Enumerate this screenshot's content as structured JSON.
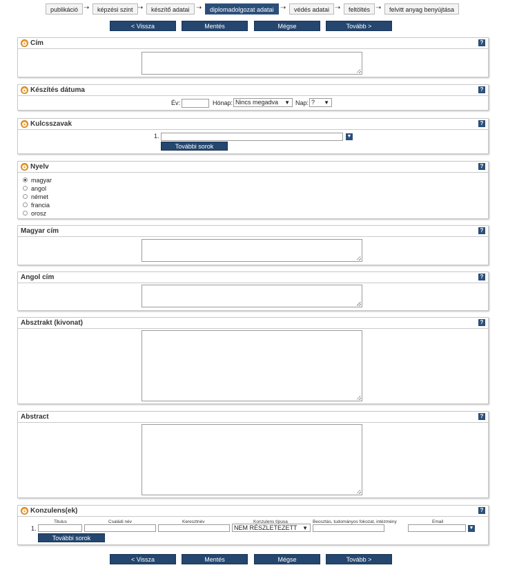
{
  "wizard": {
    "steps": [
      "publikáció",
      "képzési szint",
      "készítő adatai",
      "diplomadolgozat adatai",
      "védés adatai",
      "feltöltés",
      "felvitt anyag benyújtása"
    ],
    "active_step": "diplomadolgozat adatai"
  },
  "nav": {
    "back": "< Vissza",
    "save": "Mentés",
    "cancel": "Mégse",
    "next": "Tovább >"
  },
  "sections": {
    "title": {
      "label": "Cím",
      "required": true
    },
    "date": {
      "label": "Készítés dátuma",
      "year_label": "Év:",
      "year_value": "",
      "month_label": "Hónap:",
      "month_value": "Nincs megadva",
      "day_label": "Nap:",
      "day_value": "?"
    },
    "keywords": {
      "label": "Kulcsszavak",
      "row_number": "1.",
      "more_rows": "További sorok"
    },
    "language": {
      "label": "Nyelv",
      "options": [
        "magyar",
        "angol",
        "német",
        "francia",
        "orosz"
      ],
      "selected": "magyar"
    },
    "hungarian_title": {
      "label": "Magyar cím"
    },
    "english_title": {
      "label": "Angol cím"
    },
    "abstract_hu": {
      "label": "Absztrakt (kivonat)"
    },
    "abstract_en": {
      "label": "Abstract"
    },
    "consultants": {
      "label": "Konzulens(ek)",
      "columns": [
        "Titulus",
        "Családi név",
        "Keresztnév",
        "Konzulens típusa",
        "Beosztás, tudományos fokozat, intézmény",
        "Email"
      ],
      "row_number": "1.",
      "type_value": "NEM RÉSZLETEZETT",
      "more_rows": "További sorok"
    }
  },
  "help_icon": "?"
}
